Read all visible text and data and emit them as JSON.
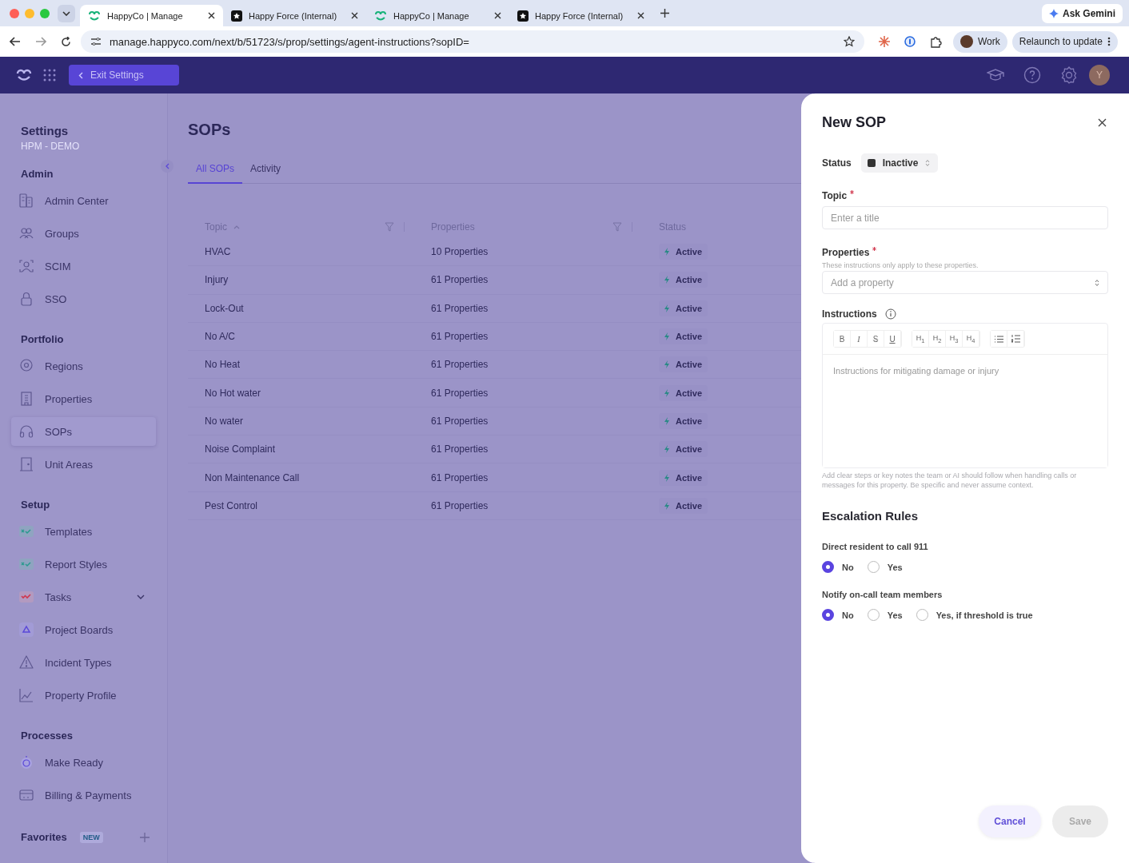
{
  "browser": {
    "tabs": [
      {
        "title": "HappyCo | Manage",
        "kind": "happyco",
        "selected": true
      },
      {
        "title": "Happy Force (Internal)",
        "kind": "star",
        "selected": false
      },
      {
        "title": "HappyCo | Manage",
        "kind": "happyco",
        "selected": false
      },
      {
        "title": "Happy Force (Internal)",
        "kind": "star",
        "selected": false
      }
    ],
    "ask_button": "Ask Gemini",
    "url": "manage.happyco.com/next/b/51723/s/prop/settings/agent-instructions?sopID=",
    "profile": "Work",
    "relaunch_button": "Relaunch to update"
  },
  "header": {
    "exit_button": "Exit Settings",
    "avatar": "Y"
  },
  "sidebar": {
    "title": "Settings",
    "subtitle": "HPM - DEMO",
    "sections": [
      {
        "title": "Admin",
        "items": [
          {
            "label": "Admin Center",
            "selected": false
          },
          {
            "label": "Groups",
            "selected": false
          },
          {
            "label": "SCIM",
            "selected": false
          },
          {
            "label": "SSO",
            "selected": false
          }
        ]
      },
      {
        "title": "Portfolio",
        "items": [
          {
            "label": "Regions",
            "selected": false
          },
          {
            "label": "Properties",
            "selected": false
          },
          {
            "label": "SOPs",
            "selected": true
          },
          {
            "label": "Unit Areas",
            "selected": false
          }
        ]
      },
      {
        "title": "Setup",
        "items": [
          {
            "label": "Templates",
            "selected": false
          },
          {
            "label": "Report Styles",
            "selected": false
          },
          {
            "label": "Tasks",
            "selected": false,
            "expanded": false
          },
          {
            "label": "Project Boards",
            "selected": false
          },
          {
            "label": "Incident Types",
            "selected": false
          },
          {
            "label": "Property Profile",
            "selected": false
          }
        ]
      },
      {
        "title": "Processes",
        "items": [
          {
            "label": "Make Ready",
            "selected": false
          },
          {
            "label": "Billing & Payments",
            "selected": false
          }
        ]
      }
    ],
    "favorites": {
      "title": "Favorites",
      "badge": "NEW"
    }
  },
  "page": {
    "title": "SOPs",
    "tabs": [
      {
        "label": "All SOPs",
        "selected": true
      },
      {
        "label": "Activity",
        "selected": false
      }
    ],
    "table": {
      "columns": [
        "Topic",
        "Properties",
        "Status"
      ],
      "rows": [
        {
          "topic": "HVAC",
          "properties": "10 Properties",
          "status": "Active"
        },
        {
          "topic": "Injury",
          "properties": "61 Properties",
          "status": "Active"
        },
        {
          "topic": "Lock-Out",
          "properties": "61 Properties",
          "status": "Active"
        },
        {
          "topic": "No A/C",
          "properties": "61 Properties",
          "status": "Active"
        },
        {
          "topic": "No Heat",
          "properties": "61 Properties",
          "status": "Active"
        },
        {
          "topic": "No Hot water",
          "properties": "61 Properties",
          "status": "Active"
        },
        {
          "topic": "No water",
          "properties": "61 Properties",
          "status": "Active"
        },
        {
          "topic": "Noise Complaint",
          "properties": "61 Properties",
          "status": "Active"
        },
        {
          "topic": "Non Maintenance Call",
          "properties": "61 Properties",
          "status": "Active"
        },
        {
          "topic": "Pest Control",
          "properties": "61 Properties",
          "status": "Active"
        }
      ]
    }
  },
  "drawer": {
    "title": "New SOP",
    "status_label": "Status",
    "status_value": "Inactive",
    "topic": {
      "label": "Topic",
      "required": true,
      "placeholder": "Enter a title"
    },
    "properties": {
      "label": "Properties",
      "required": true,
      "hint": "These instructions only apply to these properties.",
      "placeholder": "Add a property"
    },
    "instructions": {
      "label": "Instructions",
      "toolbar": [
        [
          {
            "kind": "bold",
            "label": "B"
          },
          {
            "kind": "italic",
            "label": "I"
          },
          {
            "kind": "strike",
            "label": "S"
          },
          {
            "kind": "underline",
            "label": "U"
          }
        ],
        [
          {
            "kind": "heading",
            "label": "H$_{1}$"
          },
          {
            "kind": "heading",
            "label": "H$_{2}$"
          },
          {
            "kind": "heading",
            "label": "H$_{3}$"
          },
          {
            "kind": "heading",
            "label": "H$_{4}$"
          }
        ],
        [
          {
            "kind": "bullet-list"
          },
          {
            "kind": "numbered-list"
          }
        ]
      ],
      "placeholder": "Instructions for mitigating damage or injury",
      "help": "Add clear steps or key notes the team or AI should follow when handling calls or messages for this property. Be specific and never assume context."
    },
    "escalation": {
      "title": "Escalation Rules",
      "groups": [
        {
          "label": "Direct resident to call 911",
          "options": [
            {
              "label": "No",
              "selected": true
            },
            {
              "label": "Yes",
              "selected": false
            }
          ]
        },
        {
          "label": "Notify on-call team members",
          "options": [
            {
              "label": "No",
              "selected": true
            },
            {
              "label": "Yes",
              "selected": false
            },
            {
              "label": "Yes, if threshold is true",
              "selected": false
            }
          ]
        }
      ]
    },
    "cancel_button": "Cancel",
    "save_button": {
      "label": "Save",
      "disabled": true
    }
  }
}
